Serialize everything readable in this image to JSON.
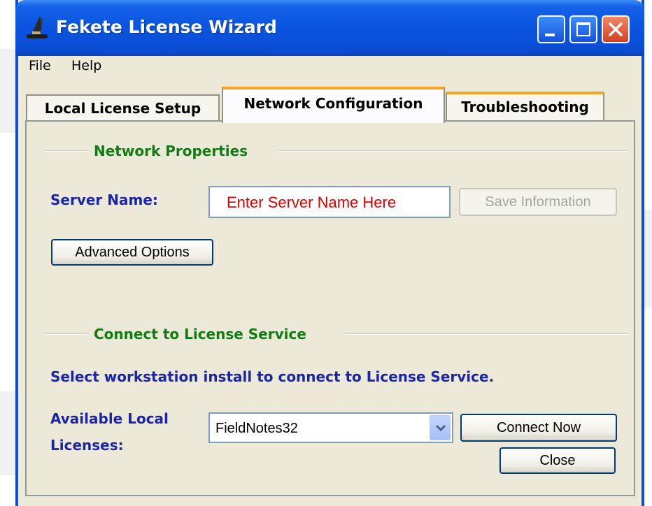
{
  "window": {
    "title": "Fekete License Wizard",
    "icon": "wizard-hat-icon"
  },
  "menu": [
    {
      "label": "File"
    },
    {
      "label": "Help"
    }
  ],
  "tabs": [
    {
      "label": "Local License Setup"
    },
    {
      "label": "Network Configuration"
    },
    {
      "label": "Troubleshooting"
    }
  ],
  "network_properties": {
    "title": "Network Properties",
    "server_label": "Server Name:",
    "server_value": "Enter Server Name Here",
    "save_label": "Save Information",
    "advanced_label": "Advanced Options"
  },
  "connect": {
    "title": "Connect to License Service",
    "instruction": "Select workstation install to connect to License Service.",
    "available_label_line1": "Available Local",
    "available_label_line2": "Licenses:",
    "selected_license": "FieldNotes32",
    "connect_label": "Connect Now",
    "close_label": "Close"
  },
  "colors": {
    "titlebar": "#0a4fd8",
    "group_title": "#157a15",
    "label_blue": "#1a25a8",
    "server_value_text": "#e00000",
    "tab_highlight": "#f4a623"
  }
}
